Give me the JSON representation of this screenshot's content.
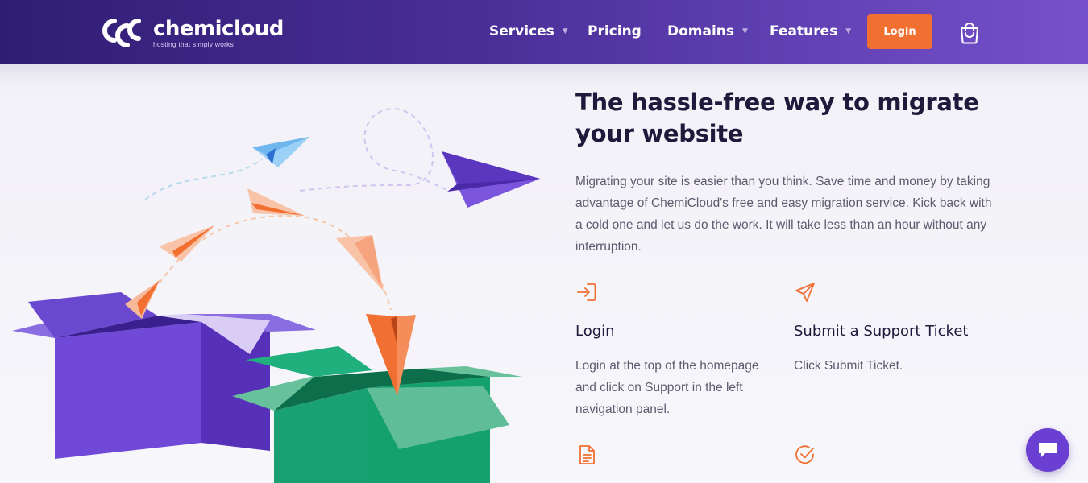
{
  "brand": {
    "name": "chemicloud",
    "tagline": "hosting that simply works"
  },
  "nav": {
    "items": [
      {
        "label": "Services",
        "dropdown": true
      },
      {
        "label": "Pricing",
        "dropdown": false
      },
      {
        "label": "Domains",
        "dropdown": true
      },
      {
        "label": "Features",
        "dropdown": true
      }
    ],
    "login_label": "Login"
  },
  "hero": {
    "title": "The hassle-free way to migrate your website",
    "intro": "Migrating your site is easier than you think. Save time and money by taking advantage of ChemiCloud's free and easy migration service. Kick back with a cold one and let us do the work. It will take less than an hour without any interruption."
  },
  "features": [
    {
      "icon": "login-arrow-icon",
      "title": "Login",
      "description": "Login at the top of the homepage and click on Support in the left navigation panel."
    },
    {
      "icon": "paper-plane-icon",
      "title": "Submit a Support Ticket",
      "description": "Click Submit Ticket."
    },
    {
      "icon": "document-icon",
      "title": "",
      "description": ""
    },
    {
      "icon": "check-circle-icon",
      "title": "",
      "description": ""
    }
  ],
  "colors": {
    "nav_gradient_start": "#2f1d73",
    "nav_gradient_end": "#7551cc",
    "accent_orange": "#f26f32",
    "heading": "#1e1a3c",
    "body_text": "#5c5b6e",
    "chat_purple": "#6a3fd1"
  }
}
